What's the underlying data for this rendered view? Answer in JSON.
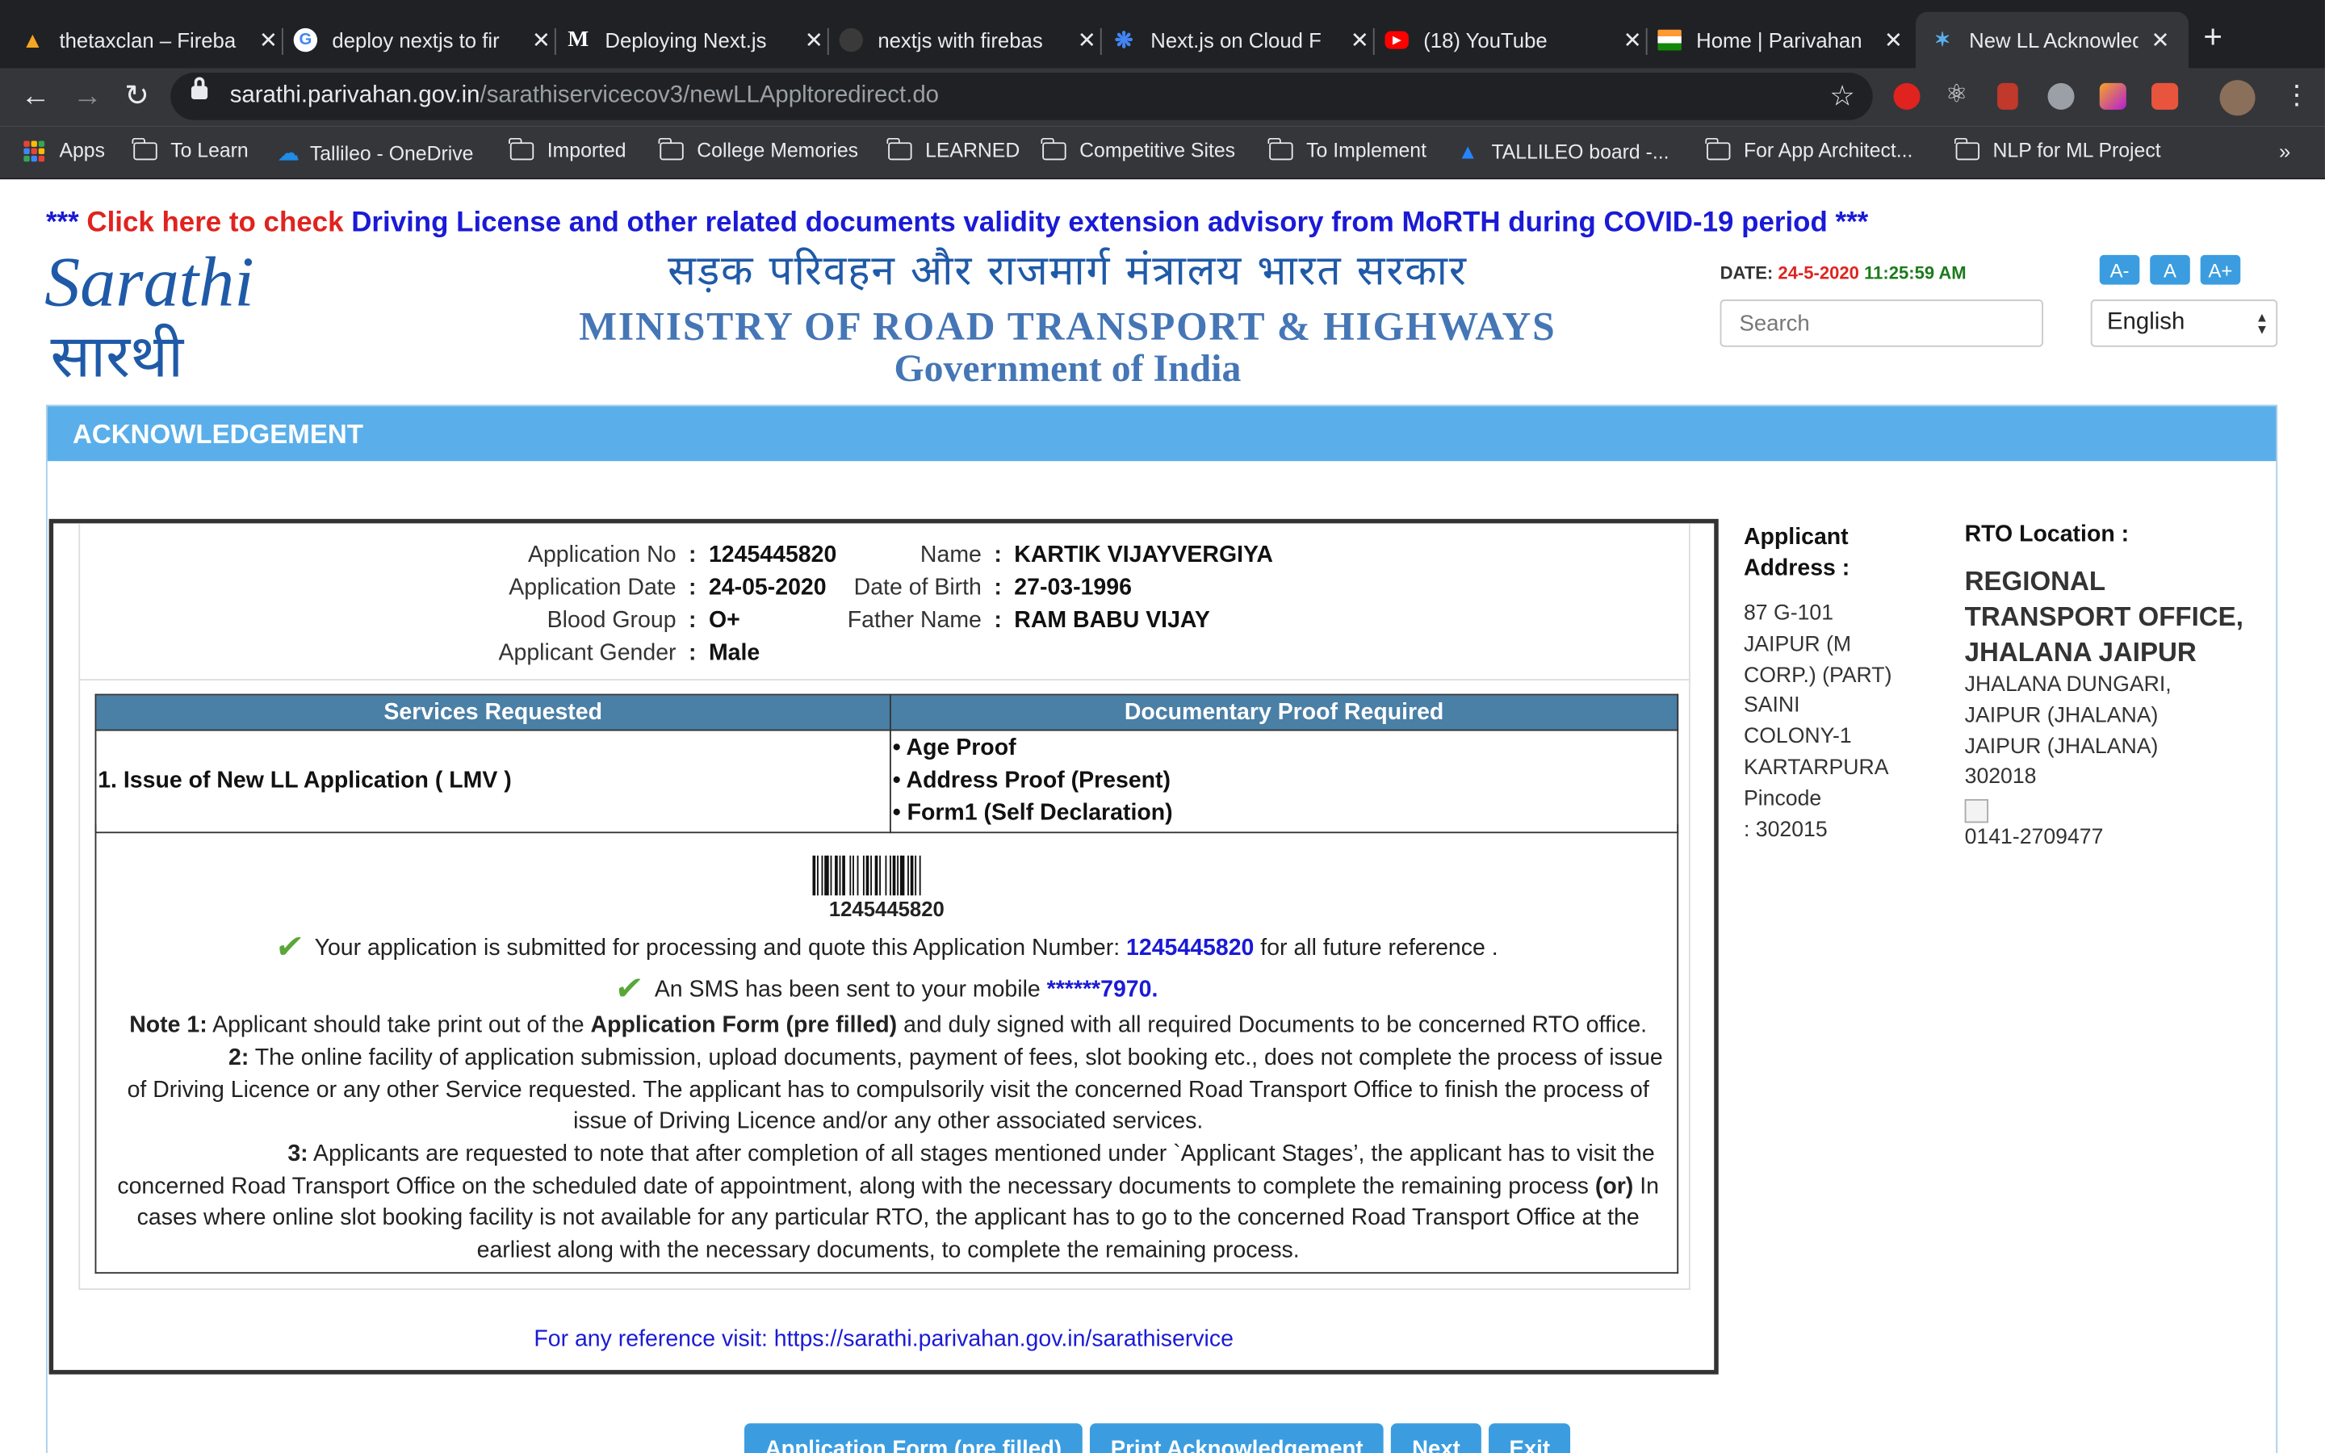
{
  "tabs": [
    {
      "title": "thetaxclan – Fireba",
      "icon": "firebase-icon",
      "color": "#f5a623"
    },
    {
      "title": "deploy nextjs to fir",
      "icon": "google-icon",
      "color": "#ffffff"
    },
    {
      "title": "Deploying Next.js",
      "icon": "medium-icon",
      "color": "#ffffff"
    },
    {
      "title": "nextjs with firebas",
      "icon": "github-icon",
      "color": "#3a3a3a"
    },
    {
      "title": "Next.js on Cloud F",
      "icon": "cloud-functions-icon",
      "color": "#4285f4"
    },
    {
      "title": "(18) YouTube",
      "icon": "youtube-icon",
      "color": "#ff0000"
    },
    {
      "title": "Home | Parivahan",
      "icon": "india-flag-icon",
      "color": "#ff9933"
    },
    {
      "title": "New LL Acknowled",
      "icon": "sarathi-icon",
      "color": "#5aafea"
    }
  ],
  "omnibox": {
    "host": "sarathi.parivahan.gov.in",
    "path": "/sarathiservicecov3/newLLAppltoredirect.do"
  },
  "bookmarks": [
    {
      "label": "Apps",
      "type": "apps"
    },
    {
      "label": "To Learn",
      "type": "folder"
    },
    {
      "label": "Tallileo - OneDrive",
      "type": "cloud"
    },
    {
      "label": "Imported",
      "type": "folder"
    },
    {
      "label": "College Memories",
      "type": "folder"
    },
    {
      "label": "LEARNED",
      "type": "folder"
    },
    {
      "label": "Competitive Sites",
      "type": "folder"
    },
    {
      "label": "To Implement",
      "type": "folder"
    },
    {
      "label": "TALLILEO board -...",
      "type": "board"
    },
    {
      "label": "For App Architect...",
      "type": "folder"
    },
    {
      "label": "NLP for ML Project",
      "type": "folder"
    }
  ],
  "advisory": {
    "prefix": "***",
    "click": "Click here to check",
    "text": "Driving License and other related documents validity extension advisory from MoRTH during COVID-19 period",
    "suffix": "***"
  },
  "header": {
    "logo_en": "Sarathi",
    "logo_hi": "सारथी",
    "hindi": "सड़क परिवहन और राजमार्ग मंत्रालय भारत सरकार",
    "ministry": "MINISTRY OF ROAD TRANSPORT & HIGHWAYS",
    "govt": "Government of India",
    "date_label": "DATE:",
    "date": "24-5-2020",
    "time": "11:25:59 AM",
    "font_buttons": [
      "A-",
      "A",
      "A+"
    ],
    "search_placeholder": "Search",
    "language": "English"
  },
  "panel_title": "ACKNOWLEDGEMENT",
  "applicant": {
    "left": [
      {
        "label": "Application No",
        "value": "1245445820"
      },
      {
        "label": "Application Date",
        "value": "24-05-2020"
      },
      {
        "label": "Blood Group",
        "value": "O+"
      },
      {
        "label": "Applicant Gender",
        "value": "Male"
      }
    ],
    "right": [
      {
        "label": "Name",
        "value": "KARTIK VIJAYVERGIYA"
      },
      {
        "label": "Date of Birth",
        "value": "27-03-1996"
      },
      {
        "label": "Father Name",
        "value": "RAM BABU VIJAY"
      }
    ]
  },
  "services": {
    "headers": [
      "Services Requested",
      "Documentary Proof Required"
    ],
    "service": "1. Issue of New LL Application ( LMV )",
    "proofs": [
      "Age Proof",
      "Address Proof (Present)",
      "Form1 (Self Declaration)"
    ]
  },
  "barcode_number": "1245445820",
  "messages": {
    "submitted_pre": "Your application is submitted for processing and quote this Application Number:",
    "app_no": "1245445820",
    "submitted_post": "for all future reference .",
    "sms_pre": "An SMS has been sent to your mobile",
    "mobile": "******7970",
    "sms_post": "."
  },
  "notes": {
    "n1_label": "Note 1:",
    "n1_a": "Applicant should take print out of the",
    "n1_bold": "Application Form (pre filled)",
    "n1_b": "and duly signed with all required Documents to be concerned RTO office.",
    "n2_label": "2:",
    "n2": "The online facility of application submission, upload documents, payment of fees, slot booking etc., does not complete the process of issue of Driving Licence or any other Service requested. The applicant has to compulsorily visit the concerned Road Transport Office to finish the process of issue of Driving Licence and/or any other associated services.",
    "n3_label": "3:",
    "n3_a": "Applicants are requested to note that after completion of all stages mentioned under `Applicant Stages’, the applicant has to visit the concerned Road Transport Office on the scheduled date of appointment, along with the necessary documents to complete the remaining process",
    "n3_or": "(or)",
    "n3_b": "In cases where online slot booking facility is not available for any particular RTO, the applicant has to go to the concerned Road Transport Office at the earliest along with the necessary documents, to complete the remaining process."
  },
  "reference": "For any reference visit: https://sarathi.parivahan.gov.in/sarathiservice",
  "address": {
    "heading": "Applicant Address :",
    "lines": [
      "87 G-101",
      "JAIPUR (M",
      "CORP.) (PART)",
      "SAINI",
      "COLONY-1",
      "KARTARPURA",
      "Pincode",
      ": 302015"
    ]
  },
  "rto": {
    "heading": "RTO Location :",
    "office": "REGIONAL TRANSPORT OFFICE, JHALANA JAIPUR",
    "lines": [
      "JHALANA DUNGARI,",
      "JAIPUR (JHALANA)",
      "JAIPUR (JHALANA)",
      "302018"
    ],
    "phone": "0141-2709477"
  },
  "buttons": [
    "Application Form (pre filled)",
    "Print Acknowledgement",
    "Next",
    "Exit"
  ]
}
